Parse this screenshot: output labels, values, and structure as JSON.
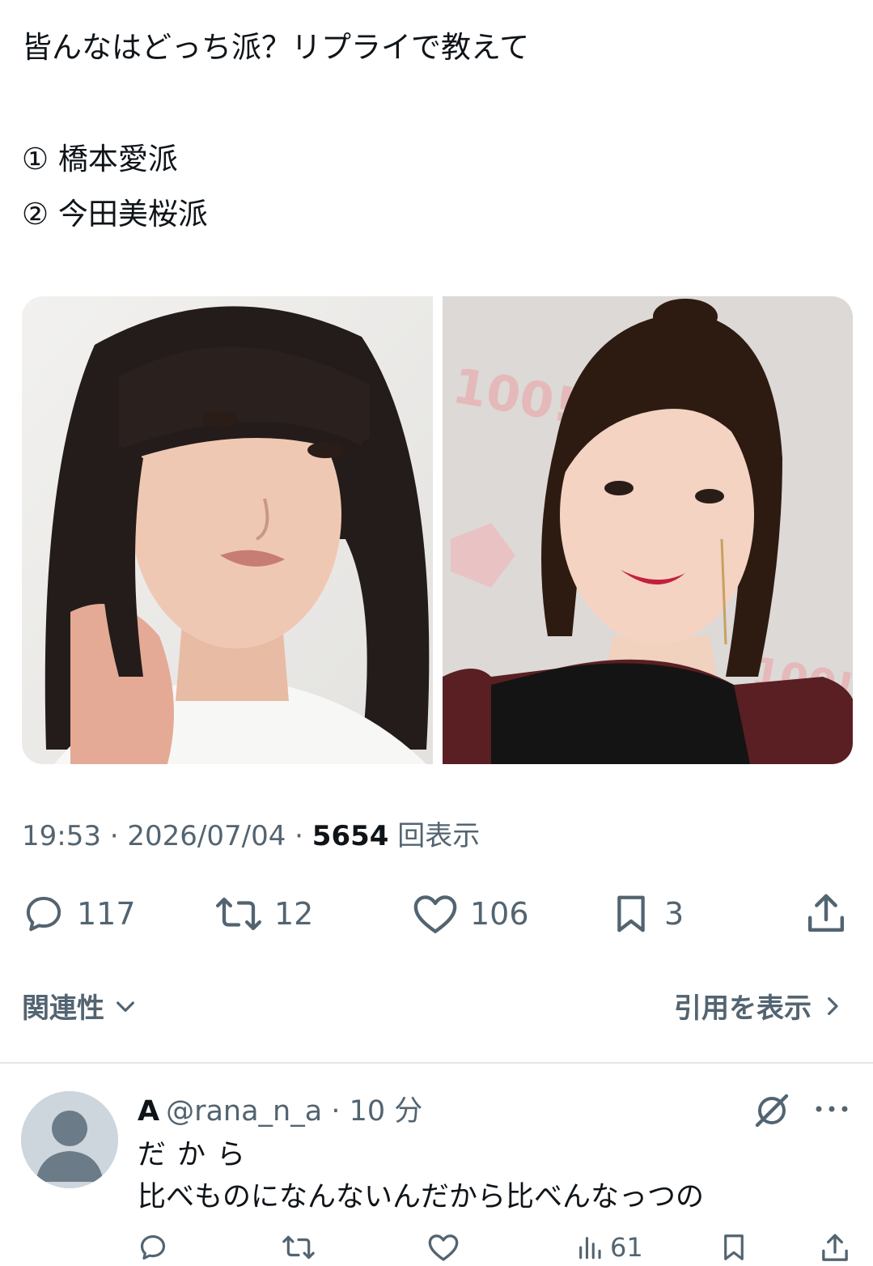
{
  "tweet": {
    "text_line1": "皆んなはどっち派？リプライで教えて",
    "option1": "① 橋本愛派",
    "option2": "② 今田美桜派",
    "time": "19:53 · 2026/07/04 · ",
    "views_count": "5654",
    "views_label": " 回表示"
  },
  "stats": {
    "replies": "117",
    "reposts": "12",
    "likes": "106",
    "bookmarks": "3"
  },
  "filters": {
    "relevance_label": "関連性",
    "quotes_label": "引用を表示"
  },
  "reply": {
    "name": "A",
    "handle": "@rana_n_a",
    "time": "· 10 分",
    "line1": "だから",
    "line2": "比べものになんないんだから比べんなっつの",
    "views": "61"
  },
  "colors": {
    "text": "#0f1419",
    "secondary": "#536471",
    "divider": "#e4e7ea"
  }
}
